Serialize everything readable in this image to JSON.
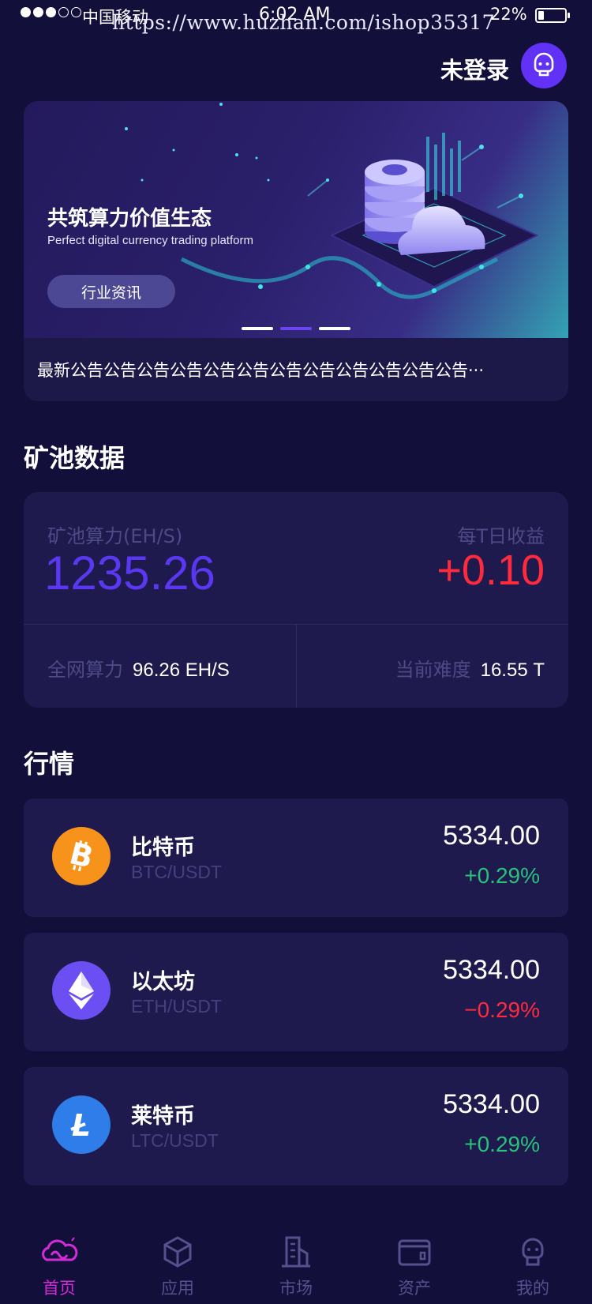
{
  "status_bar": {
    "carrier": "中国移动",
    "watermark": "https://www.huzhan.com/ishop35317",
    "time": "6:02 AM",
    "battery": "22%",
    "battery_level": 0.22
  },
  "header": {
    "login_status": "未登录",
    "avatar_icon": "robot-avatar-icon"
  },
  "banner": {
    "title": "共筑算力价值生态",
    "subtitle": "Perfect digital currency trading platform",
    "button_label": "行业资讯",
    "page_count": 3,
    "active_page": 1,
    "notice": "最新公告公告公告公告公告公告公告公告公告公告公告公告···"
  },
  "pool": {
    "section_title": "矿池数据",
    "hashrate_label": "矿池算力(EH/S)",
    "hashrate_value": "1235.26",
    "daily_income_label": "每T日收益",
    "daily_income_value": "+0.10",
    "network_label": "全网算力",
    "network_value": "96.26 EH/S",
    "difficulty_label": "当前难度",
    "difficulty_value": "16.55 T"
  },
  "market": {
    "section_title": "行情",
    "coins": [
      {
        "name": "比特币",
        "pair": "BTC/USDT",
        "price": "5334.00",
        "change": "+0.29%",
        "direction": "up",
        "icon": "bitcoin-icon",
        "color": "#f7931a"
      },
      {
        "name": "以太坊",
        "pair": "ETH/USDT",
        "price": "5334.00",
        "change": "−0.29%",
        "direction": "down",
        "icon": "ethereum-icon",
        "color": "#6b4ff2"
      },
      {
        "name": "莱特币",
        "pair": "LTC/USDT",
        "price": "5334.00",
        "change": "+0.29%",
        "direction": "up",
        "icon": "litecoin-icon",
        "color": "#2f7de8"
      }
    ]
  },
  "tabs": [
    {
      "label": "首页",
      "icon": "home-cloud-icon",
      "active": true
    },
    {
      "label": "应用",
      "icon": "cube-icon",
      "active": false
    },
    {
      "label": "市场",
      "icon": "building-icon",
      "active": false
    },
    {
      "label": "资产",
      "icon": "wallet-icon",
      "active": false
    },
    {
      "label": "我的",
      "icon": "profile-icon",
      "active": false
    }
  ],
  "colors": {
    "background": "#130f3b",
    "card": "#1e1a4d",
    "accent": "#5a37f0",
    "up": "#29c27b",
    "down": "#ff2b3d",
    "tab_active": "#d32bd8"
  }
}
